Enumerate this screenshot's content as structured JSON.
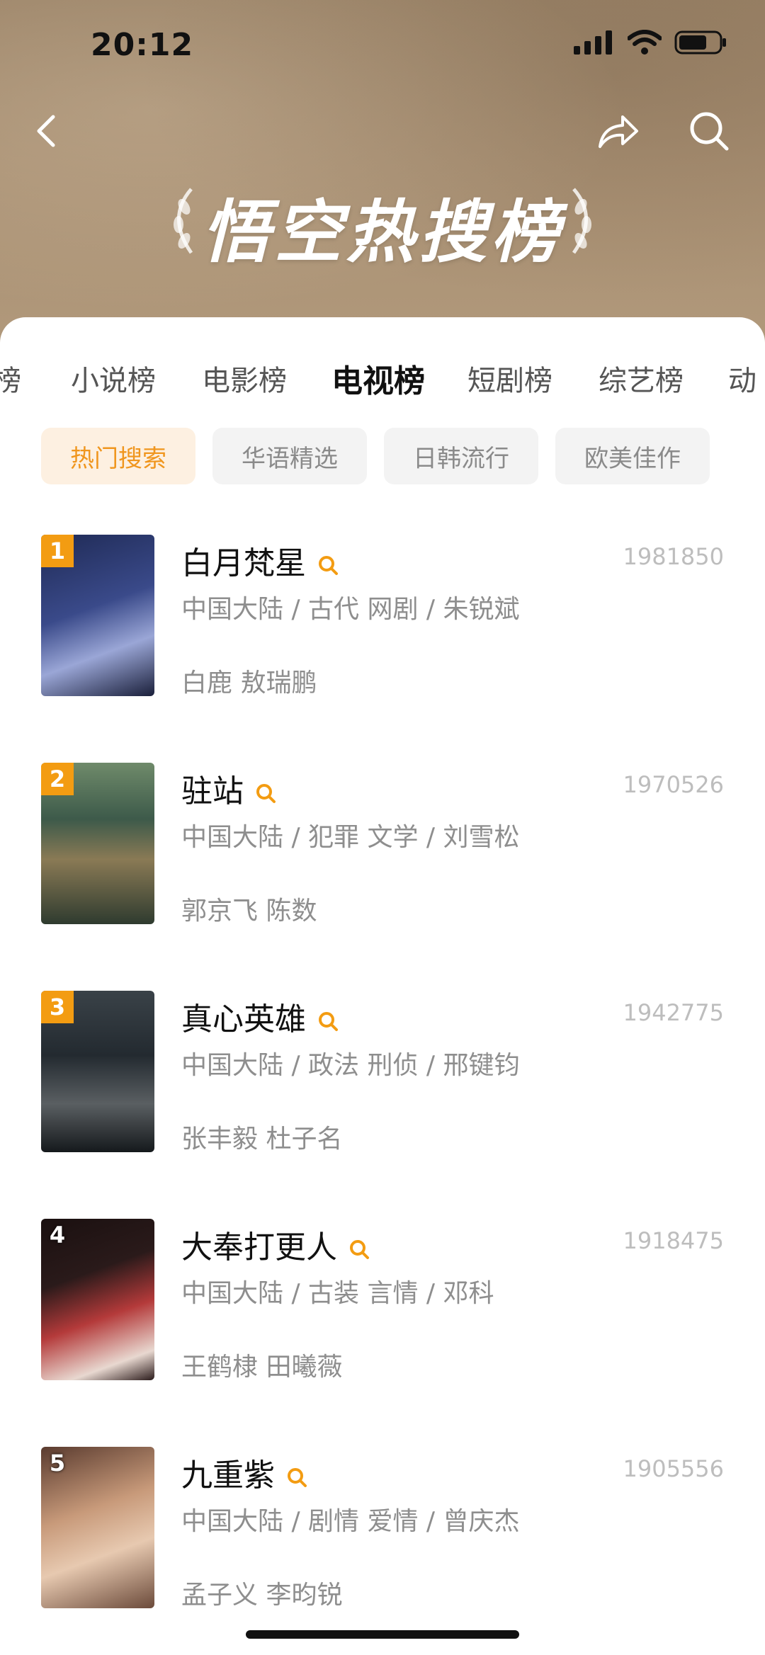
{
  "status_bar": {
    "time": "20:12"
  },
  "header": {
    "title": "悟空热搜榜",
    "icons": {
      "back": "back-icon",
      "share": "share-icon",
      "search": "search-icon"
    }
  },
  "tabs": [
    {
      "label": "榜"
    },
    {
      "label": "小说榜"
    },
    {
      "label": "电影榜"
    },
    {
      "label": "电视榜",
      "active": true
    },
    {
      "label": "短剧榜"
    },
    {
      "label": "综艺榜"
    },
    {
      "label": "动"
    }
  ],
  "chips": [
    {
      "label": "热门搜索",
      "active": true
    },
    {
      "label": "华语精选"
    },
    {
      "label": "日韩流行"
    },
    {
      "label": "欧美佳作"
    }
  ],
  "list": [
    {
      "rank": "1",
      "title": "白月梵星",
      "score": "1981850",
      "meta": "中国大陆 / 古代 网剧 / 朱锐斌",
      "cast": "白鹿 敖瑞鹏",
      "poster_colors": [
        "#1f2a55",
        "#9aa6d6"
      ]
    },
    {
      "rank": "2",
      "title": "驻站",
      "score": "1970526",
      "meta": "中国大陆 / 犯罪 文学 / 刘雪松",
      "cast": "郭京飞 陈数",
      "poster_colors": [
        "#3d5a4a",
        "#c7b77a"
      ]
    },
    {
      "rank": "3",
      "title": "真心英雄",
      "score": "1942775",
      "meta": "中国大陆 / 政法 刑侦 / 邢键钧",
      "cast": "张丰毅 杜子名",
      "poster_colors": [
        "#232a30",
        "#6b6f72"
      ]
    },
    {
      "rank": "4",
      "title": "大奉打更人",
      "score": "1918475",
      "meta": "中国大陆 / 古装 言情 / 邓科",
      "cast": "王鹤棣 田曦薇",
      "poster_colors": [
        "#2a1a1a",
        "#b43a3a"
      ]
    },
    {
      "rank": "5",
      "title": "九重紫",
      "score": "1905556",
      "meta": "中国大陆 / 剧情 爱情 / 曾庆杰",
      "cast": "孟子义 李昀锐",
      "poster_colors": [
        "#5a3b2f",
        "#e7c9b0"
      ]
    }
  ],
  "colors": {
    "accent": "#f39c12",
    "hero_bg": "#a88f72"
  }
}
